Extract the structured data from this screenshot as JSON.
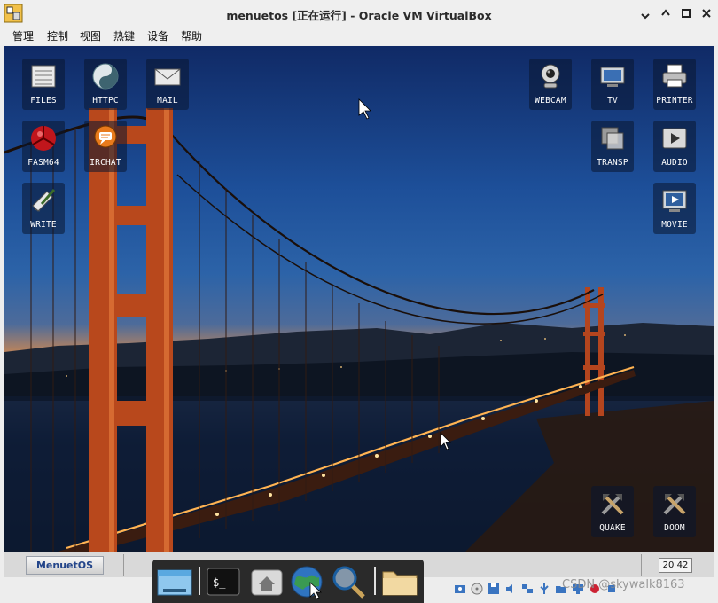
{
  "window": {
    "title": "menuetos [正在运行] - Oracle VM VirtualBox",
    "minimize_icon": "minimize-icon",
    "restore_icon": "restore-icon",
    "close_icon": "close-icon"
  },
  "menu": [
    "管理",
    "控制",
    "视图",
    "热键",
    "设备",
    "帮助"
  ],
  "desktop": {
    "icons_left": [
      {
        "label": "FILES",
        "icon": "files-icon"
      },
      {
        "label": "HTTPC",
        "icon": "yin-yang-icon"
      },
      {
        "label": "MAIL",
        "icon": "mail-icon"
      },
      {
        "label": "FASM64",
        "icon": "fasm-icon"
      },
      {
        "label": "IRCHAT",
        "icon": "chat-icon"
      },
      {
        "label": "WRITE",
        "icon": "write-icon"
      }
    ],
    "icons_right": [
      {
        "label": "WEBCAM",
        "icon": "webcam-icon"
      },
      {
        "label": "TV",
        "icon": "tv-icon"
      },
      {
        "label": "PRINTER",
        "icon": "printer-icon"
      },
      {
        "label": "TRANSP",
        "icon": "transparency-icon"
      },
      {
        "label": "AUDIO",
        "icon": "audio-icon"
      },
      {
        "label": "MOVIE",
        "icon": "movie-icon"
      },
      {
        "label": "QUAKE",
        "icon": "tools-icon"
      },
      {
        "label": "DOOM",
        "icon": "tools-icon"
      }
    ]
  },
  "taskbar": {
    "start_label": "MenuetOS",
    "clock": "20 42"
  },
  "dock": [
    "screen-icon",
    "terminal-icon",
    "home-icon",
    "browser-icon",
    "search-icon",
    "folder-icon"
  ],
  "terminal_prompt": "$_",
  "watermark": "CSDN @skywalk8163",
  "colors": {
    "accent": "#23458a",
    "dock_bg": "#2a2a2a"
  }
}
